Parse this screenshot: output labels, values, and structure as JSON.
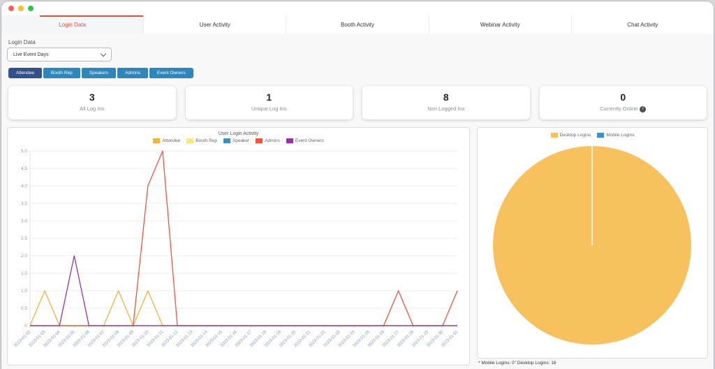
{
  "tabs": [
    {
      "label": "Login Data",
      "active": true
    },
    {
      "label": "User Activity",
      "active": false
    },
    {
      "label": "Booth Activity",
      "active": false
    },
    {
      "label": "Webinar Activity",
      "active": false
    },
    {
      "label": "Chat Activity",
      "active": false
    }
  ],
  "filters": {
    "label": "Login Data",
    "selected": "Live Event Days"
  },
  "role_filters": [
    {
      "label": "Attendee",
      "active": true
    },
    {
      "label": "Booth Rep",
      "active": false
    },
    {
      "label": "Speakers",
      "active": false
    },
    {
      "label": "Admins",
      "active": false
    },
    {
      "label": "Event Owners",
      "active": false
    }
  ],
  "stats": [
    {
      "value": "3",
      "label": "All Log Ins"
    },
    {
      "value": "1",
      "label": "Unique Log Ins"
    },
    {
      "value": "8",
      "label": "Non Logged Ins"
    },
    {
      "value": "0",
      "label": "Currently Online",
      "icon": "info"
    }
  ],
  "icons": {
    "info": "i"
  },
  "colors": {
    "accent_red": "#e0503a",
    "button_active": "#33518a",
    "button_default": "#2d87bc"
  },
  "chart_data": [
    {
      "type": "line",
      "title": "User Login Activity",
      "legend_position": "top",
      "grid": "horizontal",
      "ylim": [
        0,
        5
      ],
      "ytick_step": 0.5,
      "categories": [
        "2023-01-02",
        "2023-01-03",
        "2023-01-04",
        "2023-01-05",
        "2023-01-06",
        "2023-01-07",
        "2023-01-08",
        "2023-01-09",
        "2023-01-10",
        "2023-01-11",
        "2023-01-12",
        "2023-01-13",
        "2023-01-14",
        "2023-01-15",
        "2023-01-16",
        "2023-01-17",
        "2023-01-18",
        "2023-01-19",
        "2023-01-20",
        "2023-01-21",
        "2023-01-22",
        "2023-01-23",
        "2023-01-24",
        "2023-01-25",
        "2023-01-26",
        "2023-01-27",
        "2023-01-28",
        "2023-01-29",
        "2023-01-30",
        "2023-01-31"
      ],
      "series": [
        {
          "name": "Attendee",
          "color": "#f2b13c",
          "values": [
            0,
            1,
            0,
            0,
            0,
            0,
            1,
            0,
            1,
            0,
            0,
            0,
            0,
            0,
            0,
            0,
            0,
            0,
            0,
            0,
            0,
            0,
            0,
            0,
            0,
            0,
            0,
            0,
            0,
            0
          ]
        },
        {
          "name": "Booth Rep",
          "color": "#f0e14f",
          "pattern": "diagonal",
          "values": [
            0,
            0,
            0,
            0,
            0,
            0,
            0,
            0,
            0,
            0,
            0,
            0,
            0,
            0,
            0,
            0,
            0,
            0,
            0,
            0,
            0,
            0,
            0,
            0,
            0,
            0,
            0,
            0,
            0,
            0
          ]
        },
        {
          "name": "Speaker",
          "color": "#3a8fc7",
          "values": [
            0,
            0,
            0,
            0,
            0,
            0,
            0,
            0,
            0,
            0,
            0,
            0,
            0,
            0,
            0,
            0,
            0,
            0,
            0,
            0,
            0,
            0,
            0,
            0,
            0,
            0,
            0,
            0,
            0,
            0
          ]
        },
        {
          "name": "Admins",
          "color": "#f4523b",
          "values": [
            0,
            0,
            0,
            0,
            0,
            0,
            0,
            0,
            4,
            5,
            0,
            0,
            0,
            0,
            0,
            0,
            0,
            0,
            0,
            0,
            0,
            0,
            0,
            0,
            0,
            1,
            0,
            0,
            0,
            1
          ]
        },
        {
          "name": "Event Owners",
          "color": "#9b2fae",
          "values": [
            0,
            0,
            0,
            2,
            0,
            0,
            0,
            0,
            0,
            0,
            0,
            0,
            0,
            0,
            0,
            0,
            0,
            0,
            0,
            0,
            0,
            0,
            0,
            0,
            0,
            0,
            0,
            0,
            0,
            0
          ]
        }
      ]
    },
    {
      "type": "pie",
      "labels": [
        "Desktop Logins",
        "Mobile Logins"
      ],
      "values": [
        16,
        0
      ],
      "colors": [
        "#f7c25e",
        "#3a8fc7"
      ],
      "legend_position": "top",
      "footer": "* Mobile Logins: 0\" Desktop Logins: 16"
    }
  ]
}
